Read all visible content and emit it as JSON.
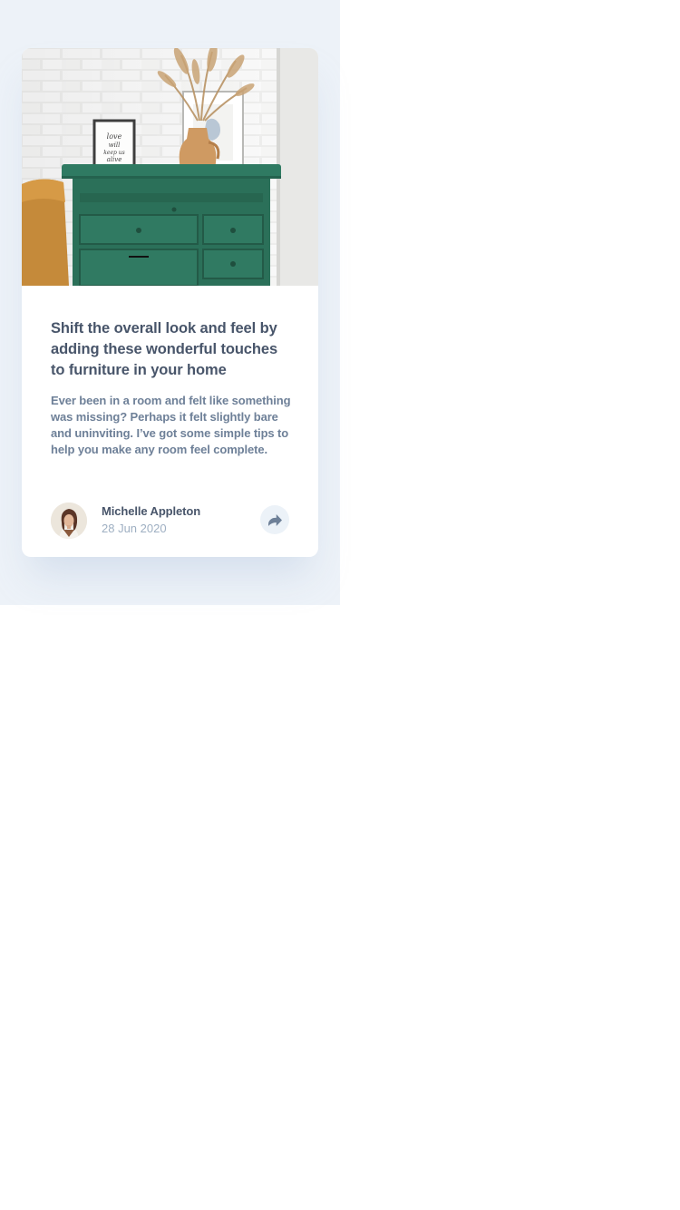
{
  "card": {
    "title": "Shift the overall look and feel by adding these wonderful touches to furniture in your home",
    "description": "Ever been in a room and felt like something was missing? Perhaps it felt slightly bare and uninviting. I’ve got some simple tips to help you make any room feel complete.",
    "author": {
      "name": "Michelle Appleton",
      "date": "28 Jun 2020"
    },
    "hero_frame_text": "love will keep us alive",
    "share_icon": "share-icon"
  },
  "colors": {
    "page_background": "#edf2f8",
    "card_background": "#ffffff",
    "title_text": "#48556a",
    "body_text": "#6e8098",
    "muted_text": "#9eafc2",
    "share_button": "#ecf2f8",
    "drawer_green": "#2f7a62"
  }
}
